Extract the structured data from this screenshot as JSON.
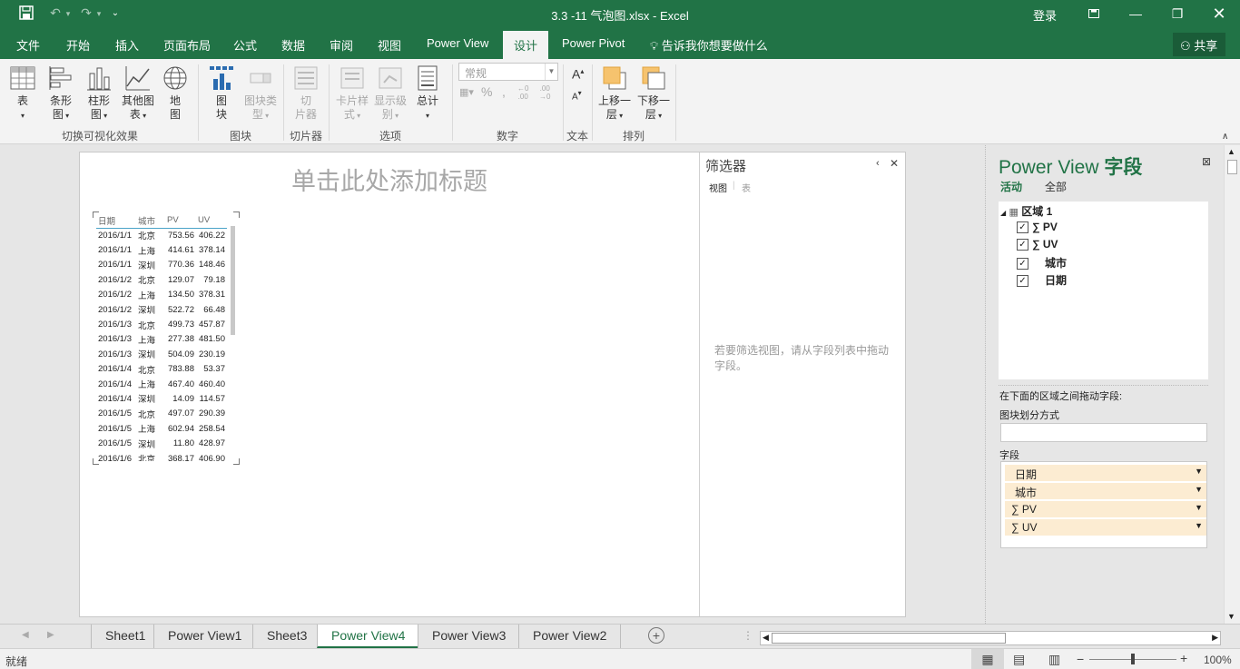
{
  "window": {
    "title": "3.3 -11 气泡图.xlsx  -  Excel",
    "login": "登录"
  },
  "tabs": [
    "文件",
    "开始",
    "插入",
    "页面布局",
    "公式",
    "数据",
    "审阅",
    "视图",
    "Power View",
    "设计",
    "Power Pivot"
  ],
  "active_tab": "设计",
  "tell_me": "告诉我你想要做什么",
  "share": "共享",
  "ribbon": {
    "groups": {
      "switch": "切换可视化效果",
      "tiles": "图块",
      "slicer": "切片器",
      "options": "选项",
      "number": "数字",
      "text": "文本",
      "arrange": "排列"
    },
    "buttons": {
      "table": [
        "表"
      ],
      "bar": [
        "条形",
        "图"
      ],
      "column": [
        "柱形",
        "图"
      ],
      "other": [
        "其他图",
        "表"
      ],
      "map": [
        "地",
        "图"
      ],
      "tile": [
        "图",
        "块"
      ],
      "tile_type": [
        "图块类",
        "型"
      ],
      "slicer": [
        "切",
        "片器"
      ],
      "card_style": [
        "卡片样",
        "式"
      ],
      "show_level": [
        "显示级",
        "别"
      ],
      "totals": [
        "总计"
      ],
      "bring_forward": [
        "上移一",
        "层"
      ],
      "send_backward": [
        "下移一",
        "层"
      ]
    },
    "number_format": "常规"
  },
  "canvas": {
    "title_placeholder": "单击此处添加标题",
    "table": {
      "columns": [
        "日期",
        "城市",
        "PV",
        "UV"
      ],
      "rows": [
        [
          "2016/1/1",
          "北京",
          "753.56",
          "406.22"
        ],
        [
          "2016/1/1",
          "上海",
          "414.61",
          "378.14"
        ],
        [
          "2016/1/1",
          "深圳",
          "770.36",
          "148.46"
        ],
        [
          "2016/1/2",
          "北京",
          "129.07",
          "79.18"
        ],
        [
          "2016/1/2",
          "上海",
          "134.50",
          "378.31"
        ],
        [
          "2016/1/2",
          "深圳",
          "522.72",
          "66.48"
        ],
        [
          "2016/1/3",
          "北京",
          "499.73",
          "457.87"
        ],
        [
          "2016/1/3",
          "上海",
          "277.38",
          "481.50"
        ],
        [
          "2016/1/3",
          "深圳",
          "504.09",
          "230.19"
        ],
        [
          "2016/1/4",
          "北京",
          "783.88",
          "53.37"
        ],
        [
          "2016/1/4",
          "上海",
          "467.40",
          "460.40"
        ],
        [
          "2016/1/4",
          "深圳",
          "14.09",
          "114.57"
        ],
        [
          "2016/1/5",
          "北京",
          "497.07",
          "290.39"
        ],
        [
          "2016/1/5",
          "上海",
          "602.94",
          "258.54"
        ],
        [
          "2016/1/5",
          "深圳",
          "11.80",
          "428.97"
        ],
        [
          "2016/1/6",
          "北京",
          "368.17",
          "406.90"
        ]
      ]
    }
  },
  "filter_pane": {
    "title": "筛选器",
    "tab_view": "视图",
    "tab_table": "表",
    "hint": "若要筛选视图，请从字段列表中拖动字段。"
  },
  "field_list": {
    "title_en": "Power View",
    "title_cn": "字段",
    "tab_active": "活动",
    "tab_all": "全部",
    "table_name": "区域 1",
    "fields": [
      {
        "label": "PV",
        "sigma": true
      },
      {
        "label": "UV",
        "sigma": true
      },
      {
        "label": "城市",
        "sigma": false
      },
      {
        "label": "日期",
        "sigma": false
      }
    ],
    "drag_hint": "在下面的区域之间拖动字段:",
    "tile_by": "图块划分方式",
    "fields_label": "字段",
    "field_wells": [
      {
        "label": "日期",
        "sigma": false
      },
      {
        "label": "城市",
        "sigma": false
      },
      {
        "label": "PV",
        "sigma": true
      },
      {
        "label": "UV",
        "sigma": true
      }
    ]
  },
  "sheets": [
    "Sheet1",
    "Power View1",
    "Sheet3",
    "Power View4",
    "Power View3",
    "Power View2"
  ],
  "active_sheet": "Power View4",
  "status": {
    "ready": "就绪",
    "zoom": "100%"
  },
  "colors": {
    "excel_green": "#217346",
    "field_chip": "#fcecd2"
  }
}
